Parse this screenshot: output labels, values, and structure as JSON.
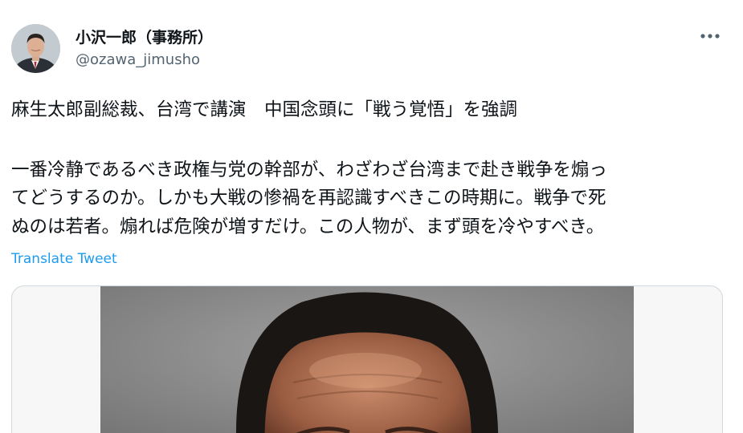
{
  "author": {
    "display_name": "小沢一郎（事務所）",
    "handle": "@ozawa_jimusho",
    "avatar": "avatar-photo"
  },
  "actions": {
    "more_icon": "more-horizontal-icon"
  },
  "tweet": {
    "lines": [
      "麻生太郎副総裁、台湾で講演　中国念頭に「戦う覚悟」を強調",
      "一番冷静であるべき政権与党の幹部が、わざわざ台湾まで赴き戦争を煽っ",
      "てどうするのか。しかも大戦の惨禍を再認識すべきこの時期に。戦争で死",
      "ぬのは若者。煽れば危険が増すだけ。この人物が、まず頭を冷やすべき。"
    ],
    "translate_label": "Translate Tweet"
  },
  "media": {
    "type": "photo"
  },
  "colors": {
    "link": "#1d9bf0",
    "secondary_text": "#536471",
    "border": "#cfd9de"
  }
}
